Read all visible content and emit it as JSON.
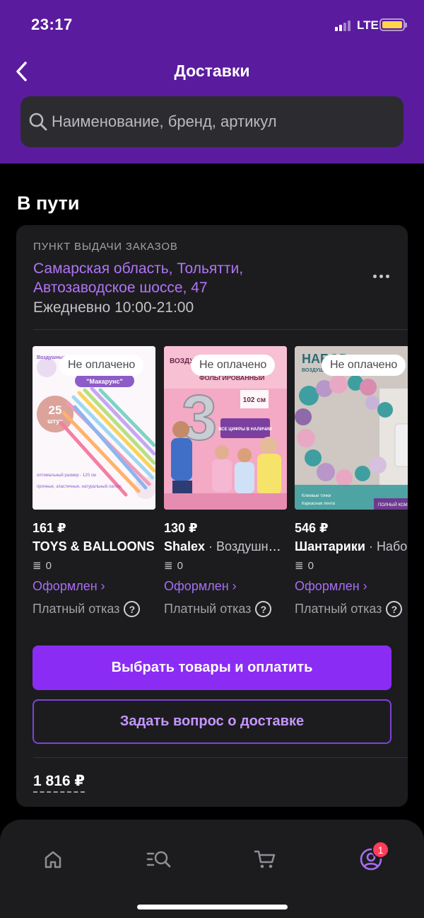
{
  "status_bar": {
    "time": "23:17",
    "network": "LTE"
  },
  "header": {
    "title": "Доставки",
    "back_icon": "chevron-left-icon"
  },
  "search": {
    "placeholder": "Наименование, бренд, артикул",
    "value": ""
  },
  "section": {
    "title": "В пути"
  },
  "delivery": {
    "pickup_label": "ПУНКТ ВЫДАЧИ ЗАКАЗОВ",
    "address": "Самарская область, Тольятти, Автозаводское шоссе, 47",
    "hours": "Ежедневно 10:00-21:00",
    "products": [
      {
        "badge": "Не оплачено",
        "price": "161 ₽",
        "brand": "TOYS & BALLOONS",
        "name": "",
        "reviews": "0",
        "status": "Оформлен ›",
        "refusal": "Платный отказ",
        "image_text": {
          "top": "Воздушные шары для моделирования",
          "tag": "\"Макарунс\"",
          "count": "25",
          "unit": "штук",
          "size": "оптимальный размер - 120 см",
          "material": "прочные, эластичные, натуральный латекс"
        }
      },
      {
        "badge": "Не оплачено",
        "price": "130 ₽",
        "brand": "Shalex",
        "name": "Воздушный шар",
        "reviews": "0",
        "status": "Оформлен ›",
        "refusal": "Платный отказ",
        "image_text": {
          "top": "ВОЗДУШНЫЙ ШАР",
          "line2": "ФОЛЬГИРОВАННЫЙ",
          "number": "3",
          "size": "102 см",
          "stock": "ВСЕ ЦИФРЫ В НАЛИЧИИ"
        }
      },
      {
        "badge": "Не оплачено",
        "price": "546 ₽",
        "brand": "Шантарики",
        "name": "Набор",
        "reviews": "0",
        "status": "Оформлен ›",
        "refusal": "Платный отказ",
        "image_text": {
          "top": "НАБОР",
          "line2": "ВОЗДУШНЫХ ШАРОВ",
          "b1": "Клеевые точки",
          "b2": "Каркасная лента",
          "b3": "ПОЛНЫЙ КОМПЛЕКТ"
        }
      }
    ],
    "buttons": {
      "pay": "Выбрать товары и оплатить",
      "ask": "Задать вопрос о доставке"
    },
    "total": "1 816 ₽"
  },
  "tabbar": {
    "items": [
      "home-icon",
      "catalog-search-icon",
      "cart-icon",
      "profile-icon"
    ],
    "profile_badge": "1"
  },
  "colors": {
    "header": "#5a1b9e",
    "accent": "#8b2cf5",
    "link": "#b175f5",
    "card": "#1c1c1f"
  }
}
